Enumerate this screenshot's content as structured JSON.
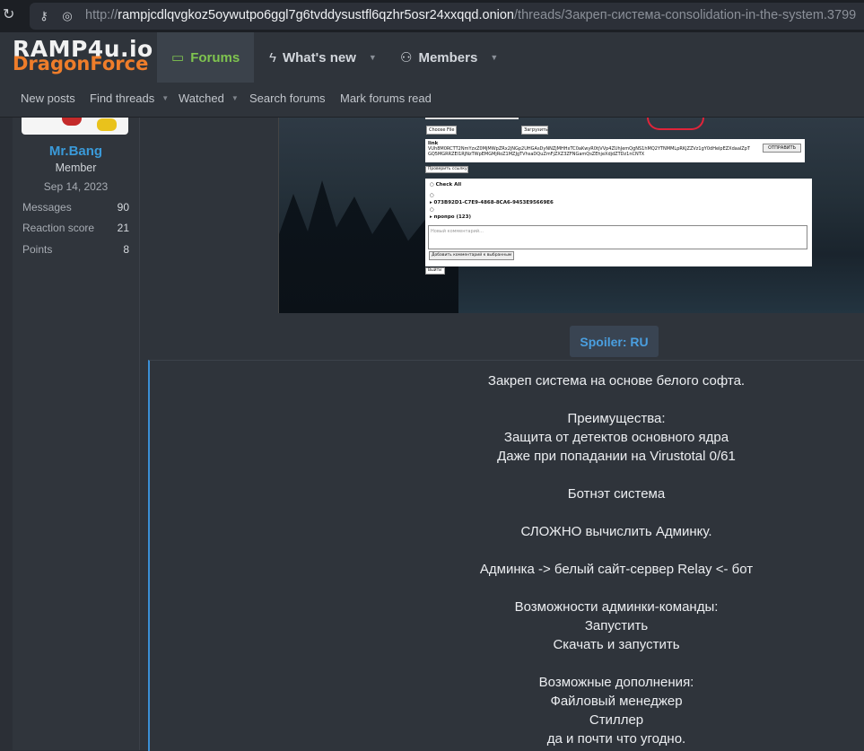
{
  "browser": {
    "url_scheme": "http://",
    "url_host": "rampjcdlqvgkoz5oywutpo6ggl7g6tvddysustfl6qzhr5osr24xxqqd.onion",
    "url_path": "/threads/Закреп-система-consolidation-in-the-system.3799"
  },
  "header": {
    "logo_top": "RAMP4u.io",
    "logo_bottom": "DragonForce",
    "tabs": [
      {
        "label": "Forums",
        "icon": "chat-bubble-icon",
        "active": true
      },
      {
        "label": "What's new",
        "icon": "lightning-icon"
      },
      {
        "label": "Members",
        "icon": "members-icon"
      }
    ]
  },
  "subnav": {
    "items": [
      "New posts",
      "Find threads",
      "Watched",
      "Search forums",
      "Mark forums read"
    ]
  },
  "user": {
    "name": "Mr.Bang",
    "role": "Member",
    "joined": "Sep 14, 2023",
    "stats": [
      {
        "label": "Messages",
        "value": "90"
      },
      {
        "label": "Reaction score",
        "value": "21"
      },
      {
        "label": "Points",
        "value": "8"
      }
    ]
  },
  "embedded_screenshot": {
    "choose_file": "Choose File",
    "upload": "Загрузить",
    "link_label": "link",
    "link_value": "VUh8M0RCTT2NmYzxZ0MjMWpZRx2jNGp2UHGAsDyNNZjMHHxTC0aKwyR0tjVVp4ZUhJemQgNS1hMQ2YTNMMLpRKjZZVz1gY0dHelpEZXdaalZpTGQ5MGRRZEl1RJNzTWpEMGMjRoZ1MZJgTVhsaDQuZmFjZXZ3ZFNGamQsZEhjeXdjdZTDz1nCNTX",
    "send": "ОТПРАВИТЬ",
    "check_link": "Проверить ссылку",
    "check_all": "Check All",
    "entry_id": "073B92D1-C7E9-4868-8CA6-9453E95669E6",
    "entry_propo": "пропро (123)",
    "comment_placeholder": "Новый комментарий...",
    "add_comment": "Добавить комментарий к выбранным",
    "exit": "Выйти"
  },
  "spoiler": {
    "button_label": "Spoiler: RU",
    "lines": [
      "Закреп система на основе белого софта.",
      "",
      "Преимущества:",
      "Защита от детектов основного ядра",
      "Даже при попадании на Virustotal 0/61",
      "",
      "Ботнэт система",
      "",
      "СЛОЖНО вычислить Админку.",
      "",
      "Админка -> белый сайт-сервер Relay <- бот",
      "",
      "Возможности админки-команды:",
      "Запустить",
      "Скачать и запустить",
      "",
      "Возможные дополнения:",
      "Файловый менеджер",
      "Стиллер",
      "да и почти что угодно."
    ]
  },
  "colors": {
    "accent_green": "#7fc44f",
    "accent_blue": "#3a9ad9",
    "logo_orange": "#ef7d2a"
  }
}
